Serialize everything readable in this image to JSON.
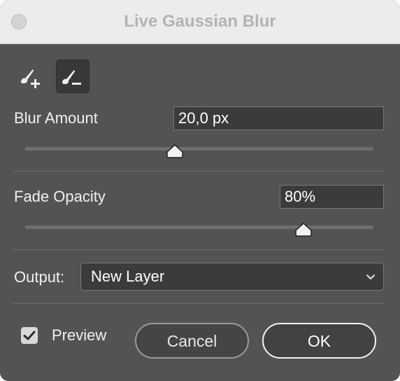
{
  "window": {
    "title": "Live Gaussian Blur"
  },
  "tools": [
    {
      "name": "brush-add",
      "icon": "brush-plus-icon",
      "selected": false
    },
    {
      "name": "brush-subtract",
      "icon": "brush-minus-icon",
      "selected": true
    }
  ],
  "blur": {
    "label": "Blur Amount",
    "value": "20,0 px",
    "slider_fraction": 0.43
  },
  "fade": {
    "label": "Fade Opacity",
    "value": "80%",
    "slider_fraction": 0.8
  },
  "output": {
    "label": "Output:",
    "selected": "New Layer"
  },
  "preview": {
    "label": "Preview",
    "checked": true
  },
  "buttons": {
    "cancel": "Cancel",
    "ok": "OK"
  },
  "colors": {
    "dialog_bg": "#535353",
    "titlebar_bg": "#ececec",
    "field_bg": "#3b3b3b"
  }
}
